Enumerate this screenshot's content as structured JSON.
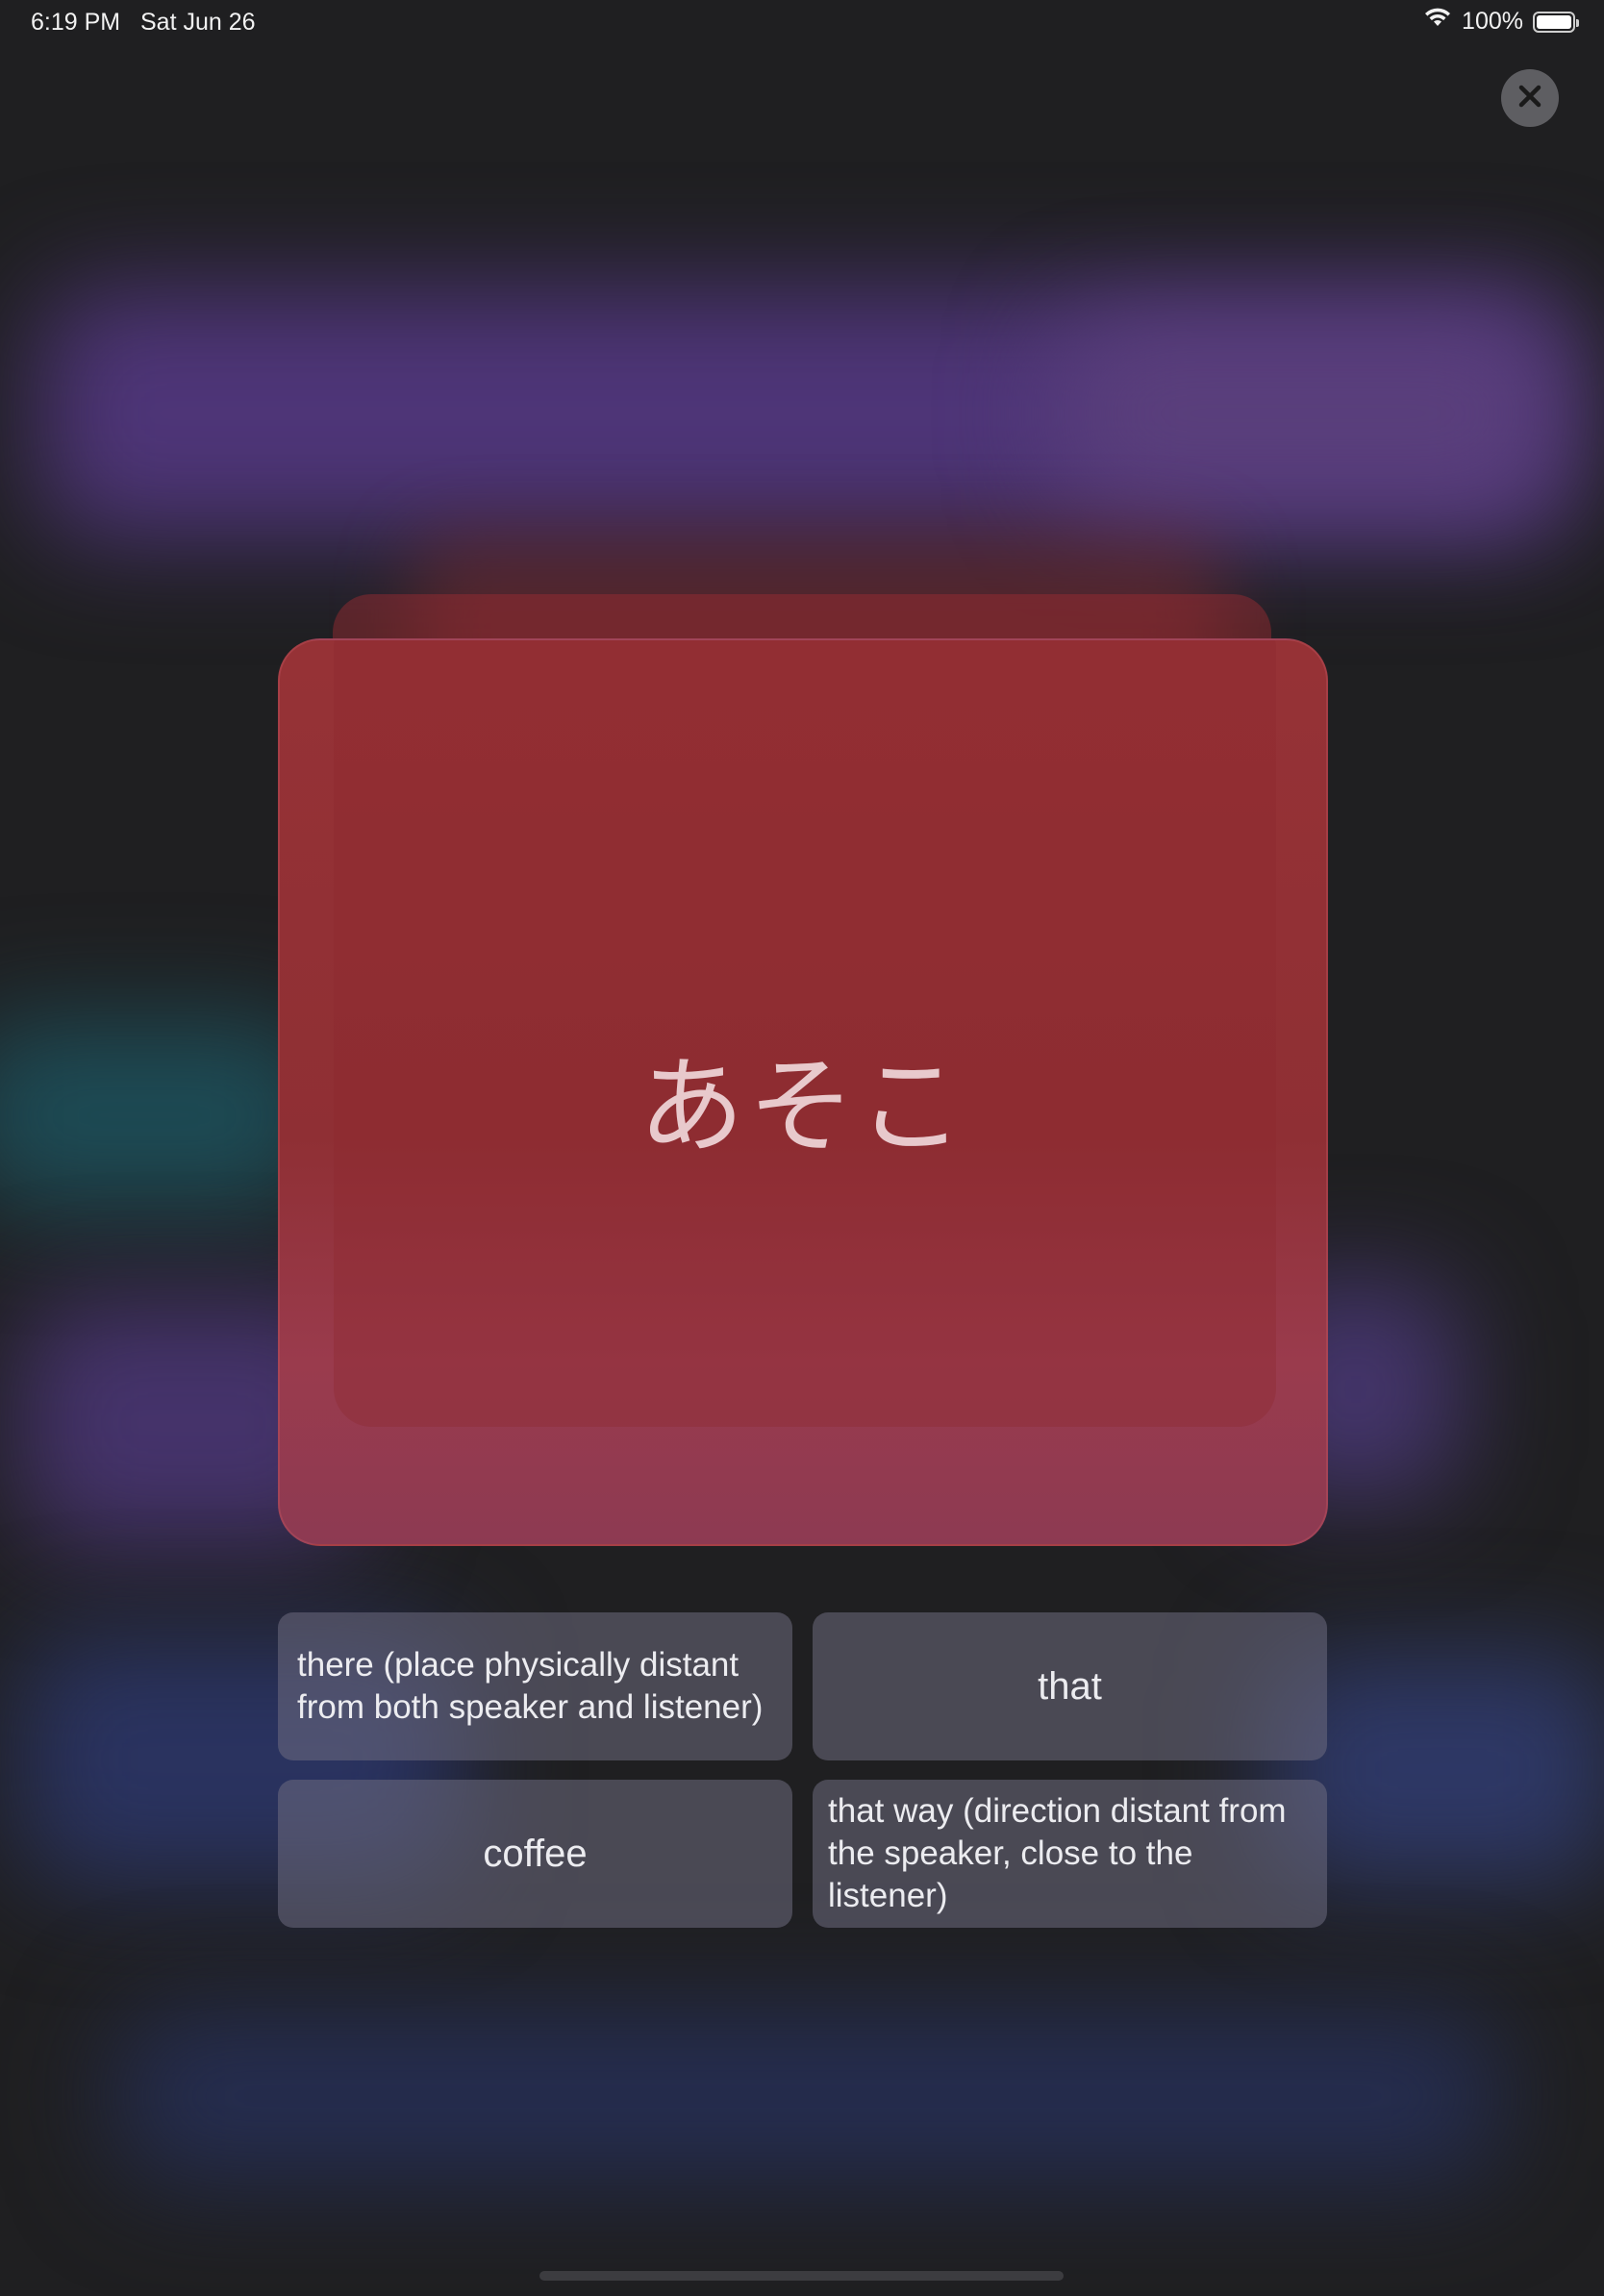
{
  "status_bar": {
    "time": "6:19 PM",
    "date": "Sat Jun 26",
    "battery": "100%",
    "icons": [
      "wifi-icon",
      "battery-icon"
    ]
  },
  "close_button": {
    "icon": "close-icon"
  },
  "flashcard": {
    "word": "あそこ"
  },
  "answers": [
    {
      "label": "there (place physically distant from both speaker and listener)"
    },
    {
      "label": "that"
    },
    {
      "label": "coffee"
    },
    {
      "label": "that way (direction distant from the speaker, close to the listener)"
    }
  ],
  "colors": {
    "background": "#1f1f21",
    "card": "#963236",
    "card_text": "#e8c9cc",
    "answer_bg": "#6e6c80",
    "close_bg": "#5e5e62"
  }
}
